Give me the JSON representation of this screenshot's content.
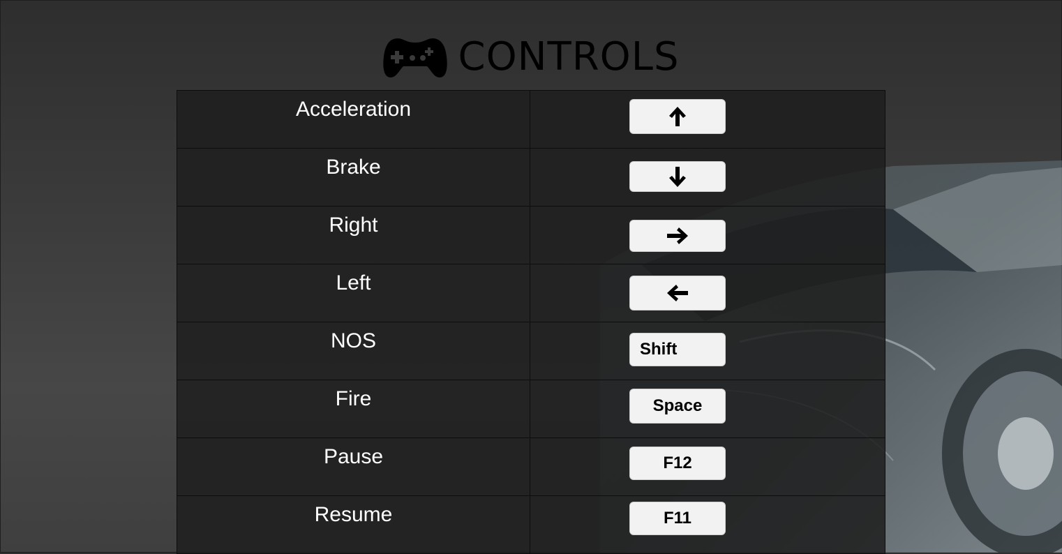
{
  "title": {
    "text": "CONTROLS",
    "icon": "gamepad-icon"
  },
  "controls": [
    {
      "action": "Acceleration",
      "key": "",
      "icon": "arrow-up-icon"
    },
    {
      "action": "Brake",
      "key": "",
      "icon": "arrow-down-icon"
    },
    {
      "action": "Right",
      "key": "",
      "icon": "arrow-right-icon"
    },
    {
      "action": "Left",
      "key": "",
      "icon": "arrow-left-icon"
    },
    {
      "action": "NOS",
      "key": "Shift"
    },
    {
      "action": "Fire",
      "key": "Space"
    },
    {
      "action": "Pause",
      "key": "F12"
    },
    {
      "action": "Resume",
      "key": "F11"
    }
  ],
  "colors": {
    "background": "#3a3a3a",
    "row": "#1e1e1e",
    "keycap": "#f2f2f2",
    "title": "#000000"
  }
}
